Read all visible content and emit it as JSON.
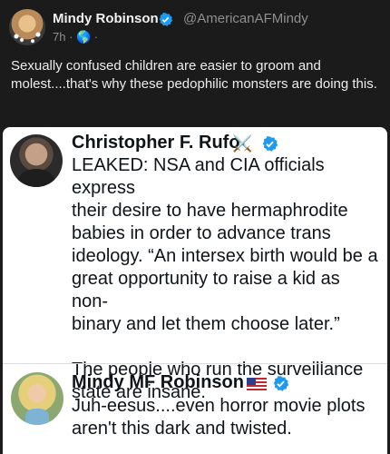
{
  "header": {
    "name": "Mindy Robinson",
    "handle": "@AmericanAFMindy",
    "meta": "7h · 🌎 ·",
    "text": "Sexually confused children are easier to groom and molest....that's why these pedophilic monsters are doing this."
  },
  "quote": {
    "author": {
      "name": "Christopher F. Rufo",
      "badge_emoji": "⚔️"
    },
    "text_lines": [
      "LEAKED: NSA and CIA officials express",
      "their desire to have hermaphrodite",
      "babies in order to advance trans",
      "ideology. “An intersex birth would be a",
      "great opportunity to raise a kid as non-",
      "binary and let them choose later.”",
      "",
      "The people who run the surveillance",
      "state are insane."
    ]
  },
  "reply": {
    "name": "Mindy MF Robinson",
    "text_lines": [
      "Juh-eesus....even horror movie plots",
      "aren't this dark and twisted."
    ]
  },
  "colors": {
    "verified": "#1d9bf0",
    "dark_bg": "#1b1b1b",
    "card_bg": "#ffffff"
  }
}
